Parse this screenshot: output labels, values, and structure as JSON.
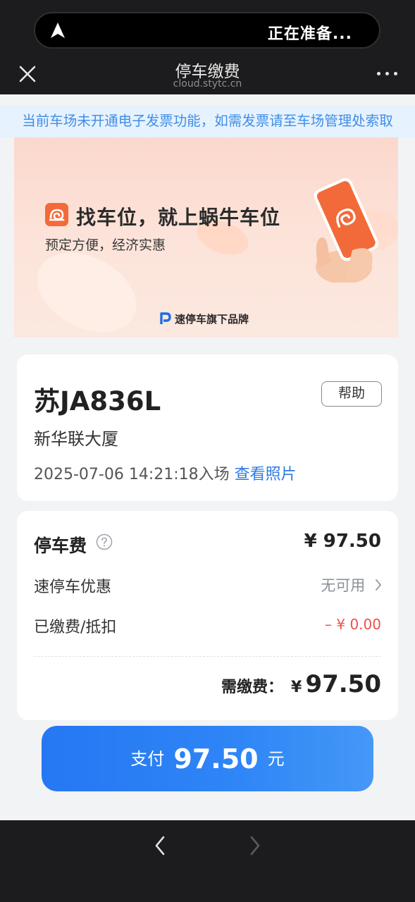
{
  "status_bar": {
    "island_text": "正在准备...",
    "icon": "navigation-arrow-icon"
  },
  "title_bar": {
    "title": "停车缴费",
    "subtitle": "cloud.stytc.cn",
    "close_icon": "close-icon",
    "more_icon": "more-icon"
  },
  "notice": {
    "text": "当前车场未开通电子发票功能，如需发票请至车场管理处索取"
  },
  "banner": {
    "title": "找车位，就上蜗牛车位",
    "subtitle": "预定方便，经济实惠",
    "brand": "速停车旗下品牌",
    "colors": {
      "accent": "#f26a3a",
      "background": "#fbd8cd"
    }
  },
  "vehicle": {
    "plate": "苏JA836L",
    "help_label": "帮助",
    "lot_name": "新华联大厦",
    "entry_time": "2025-07-06 14:21:18入场",
    "view_photo": "查看照片"
  },
  "fees": {
    "parking_fee_label": "停车费",
    "parking_fee_value": "¥ 97.50",
    "discount_label": "速停车优惠",
    "discount_value": "无可用",
    "paid_label": "已缴费/抵扣",
    "paid_value": "– ¥ 0.00",
    "due_label": "需缴费：",
    "due_currency": "¥",
    "due_value": "97.50"
  },
  "pay_button": {
    "prefix": "支付",
    "amount": "97.50",
    "unit": "元",
    "color": "#2677f3"
  },
  "bottom_nav": {
    "back_icon": "chevron-left-icon",
    "forward_icon": "chevron-right-icon"
  }
}
